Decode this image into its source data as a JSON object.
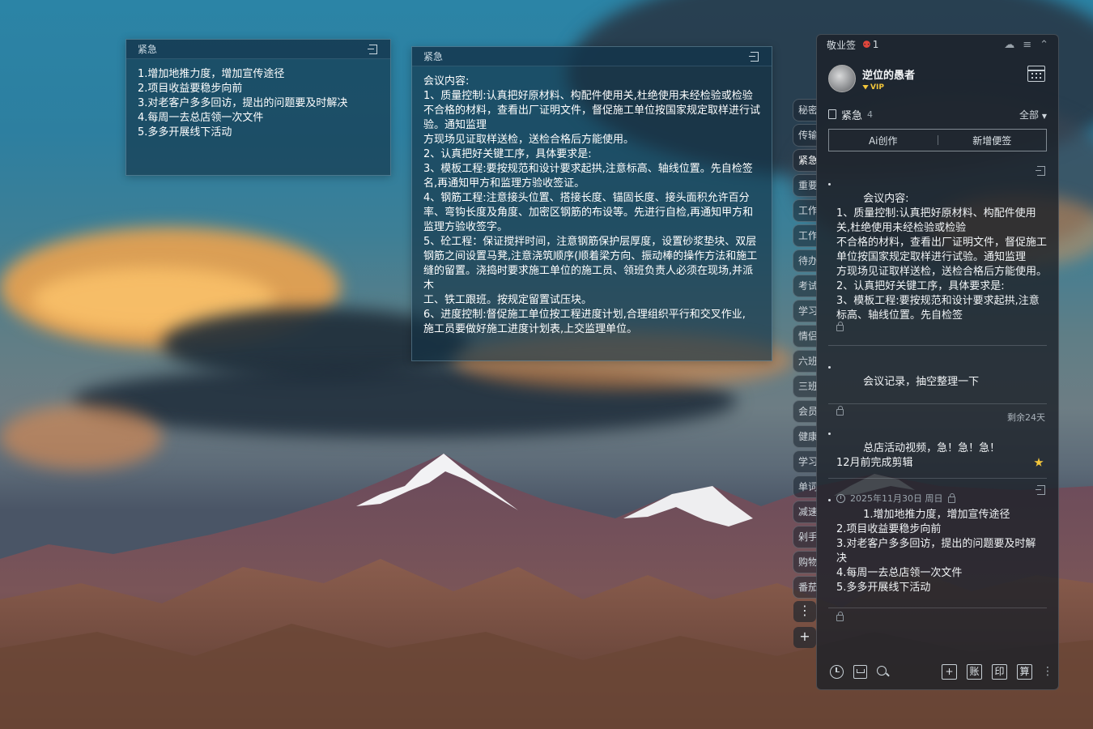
{
  "note1": {
    "title": "紧急",
    "body": "1.增加地推力度，增加宣传途径\n2.项目收益要稳步向前\n3.对老客户多多回访，提出的问题要及时解决\n4.每周一去总店领一次文件\n5.多多开展线下活动"
  },
  "note2": {
    "title": "紧急",
    "body": "会议内容:\n1、质量控制:认真把好原材料、构配件使用关,杜绝使用未经检验或检验\n不合格的材料，查看出厂证明文件，督促施工单位按国家规定取样进行试\n验。通知监理\n方现场见证取样送检，送检合格后方能使用。\n2、认真把好关键工序，具体要求是:\n3、模板工程:要按规范和设计要求起拱,注意标高、轴线位置。先自检签\n名,再通知甲方和监理方验收签证。\n4、钢筋工程:注意接头位置、搭接长度、锚固长度、接头面积允许百分\n率、弯钩长度及角度、加密区钢筋的布设等。先进行自检,再通知甲方和\n监理方验收签字。\n5、砼工程：保证搅拌时间，注意钢筋保护层厚度，设置砂浆垫块、双层\n钢筋之间设置马凳,注意浇筑顺序(顺着梁方向、振动棒的操作方法和施工\n缝的留置。浇捣时要求施工单位的施工员、领班负责人必须在现场,并派\n木\n工、铁工跟班。按规定留置试压块。\n6、进度控制:督促施工单位按工程进度计划,合理组织平行和交叉作业,\n施工员要做好施工进度计划表,上交监理单位。"
  },
  "side_tabs": [
    "秘密",
    "传输",
    "紧急",
    "重要",
    "工作",
    "工作",
    "待办",
    "考试",
    "学习",
    "情侣",
    "六班",
    "三班",
    "会员",
    "健康",
    "学习",
    "单词",
    "减速",
    "剁手",
    "购物",
    "番茄"
  ],
  "side_tools": {
    "more": "⋮",
    "add": "+"
  },
  "panel": {
    "app_name": "敬业签",
    "bell_count": "1",
    "user_name": "逆位的愚者",
    "vip_label": "VIP",
    "category": "紧急",
    "category_count": "4",
    "filter_label": "全部",
    "ai_button": "Ai创作",
    "new_button": "新增便签",
    "items": [
      {
        "text": "会议内容:\n1、质量控制:认真把好原材料、构配件使用关,杜绝使用未经检验或检验\n不合格的材料，查看出厂证明文件，督促施工单位按国家规定取样进行试验。通知监理\n方现场见证取样送检，送检合格后方能使用。\n2、认真把好关键工序，具体要求是:\n3、模板工程:要按规范和设计要求起拱,注意标高、轴线位置。先自检签\n名,再通知甲方和监理方验收签证。"
      },
      {
        "text": "会议记录，抽空整理一下"
      },
      {
        "remain": "剩余24天",
        "text": "总店活动视频，急！急！急！\n12月前完成剪辑",
        "date": "2025年11月30日 周日"
      },
      {
        "text": "1.增加地推力度，增加宣传途径\n2.项目收益要稳步向前\n3.对老客户多多回访，提出的问题要及时解\n决\n4.每周一去总店领一次文件\n5.多多开展线下活动"
      }
    ],
    "bottom_icons": [
      "clock-icon",
      "inbox-icon",
      "search-icon"
    ],
    "bottom_boxes": [
      "+",
      "账",
      "印",
      "算"
    ]
  },
  "colors": {
    "accent_vip": "#f3c63b",
    "alert_red": "#e0463c"
  }
}
